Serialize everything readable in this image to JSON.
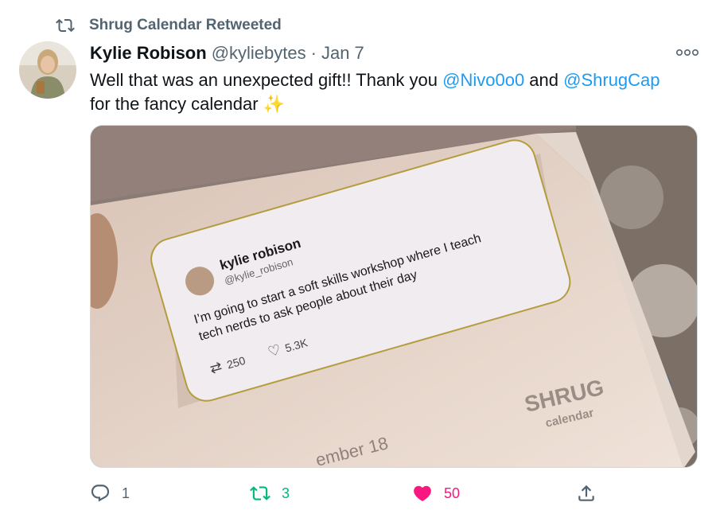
{
  "retweet_banner": {
    "text": "Shrug Calendar Retweeted",
    "icon": "retweet-icon"
  },
  "tweet": {
    "author_name": "Kylie Robison",
    "handle": "@kyliebytes",
    "separator": "·",
    "date": "Jan 7",
    "text_line1_a": "Well that was an unexpected gift!! Thank you ",
    "mention1": "@Nivo0o0",
    "text_line1_b": " and ",
    "mention2": "@ShrugCap",
    "text_line2": "for the fancy calendar ",
    "emoji": "✨"
  },
  "media": {
    "card": {
      "name": "kylie robison",
      "handle": "@kylie_robison",
      "text_line1": "I’m going to start a soft skills workshop where I teach",
      "text_line2": "tech nerds to ask people about their day",
      "retweets": "250",
      "likes": "5.3K"
    },
    "brand_top": "SHRUG",
    "brand_bottom": "calendar",
    "page_date": "ember 18"
  },
  "actions": {
    "reply_count": "1",
    "retweet_count": "3",
    "like_count": "50"
  },
  "colors": {
    "accent": "#1d9bf0",
    "retweet_active": "#00ba7c",
    "like_active": "#f91880",
    "secondary_text": "#536471"
  }
}
